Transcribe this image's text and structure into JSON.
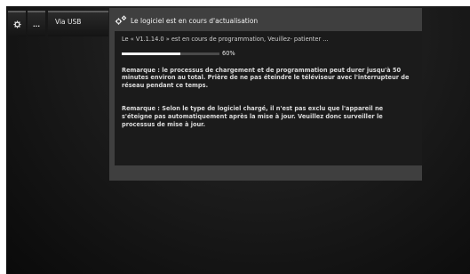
{
  "menu": {
    "gear_icon": "gear-icon",
    "more_label": "...",
    "usb_label": "Via USB"
  },
  "dialog": {
    "title_icon": "gears-icon",
    "title": "Le logiciel est en cours d'actualisation",
    "status": "Le « V1.1.14.0 » est en cours de programmation, Veuillez- patienter  ...",
    "progress_value": 0.6,
    "progress_label": "60%",
    "remark1": "Remarque : le processus de chargement et de programmation peut durer jusqu'à 50 minutes environ au total. Prière de ne pas éteindre le téléviseur avec l'interrupteur de réseau pendant ce temps.",
    "remark2": "Remarque : Selon le type de logiciel chargé, il n'est pas exclu que l'appareil ne s'éteigne pas automatiquement après la mise à jour. Veuillez donc surveiller le processus de mise à jour."
  },
  "colors": {
    "dialog_bg": "#3f3f3f",
    "body_bg": "#1b1b1b",
    "progress_fill": "#f2f2f2"
  }
}
